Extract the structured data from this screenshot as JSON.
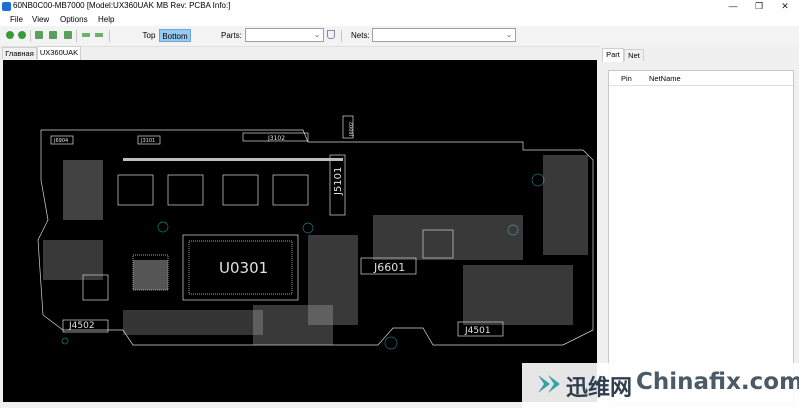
{
  "window": {
    "title": "60NB0C00-MB7000 [Model:UX360UAK MB Rev: PCBA Info:]",
    "minimize_glyph": "—",
    "restore_glyph": "❐",
    "close_glyph": "✕"
  },
  "menu": [
    "File",
    "View",
    "Options",
    "Help"
  ],
  "toolbar": {
    "icons": [
      "zoom-in-icon",
      "zoom-out-icon",
      "zoom-fit-icon",
      "zoom-area-icon",
      "rotate-icon",
      "back-icon",
      "forward-icon"
    ],
    "top_label": "Top",
    "bottom_label": "Bottom",
    "active_side": "Bottom",
    "parts_label": "Parts:",
    "parts_value": "",
    "nets_label": "Nets:",
    "nets_value": "",
    "accent": "#99c9ef"
  },
  "tabs": [
    {
      "label": "Главная",
      "active": false
    },
    {
      "label": "UX360UAK",
      "active": true
    }
  ],
  "board": {
    "background": "#000000",
    "trace_color": "#d8d8d8",
    "labels": [
      "U0301",
      "J6601",
      "J5101",
      "J4502",
      "J4501",
      "J3102",
      "J6904",
      "J3101",
      "J6002"
    ]
  },
  "right_panel": {
    "tabs": [
      {
        "label": "Part",
        "active": true
      },
      {
        "label": "Net",
        "active": false
      }
    ],
    "columns": [
      "Pin",
      "NetName"
    ]
  },
  "watermark": {
    "cn": "迅维网",
    "en": "Chinafix.com",
    "color": "#3aa0a8"
  }
}
